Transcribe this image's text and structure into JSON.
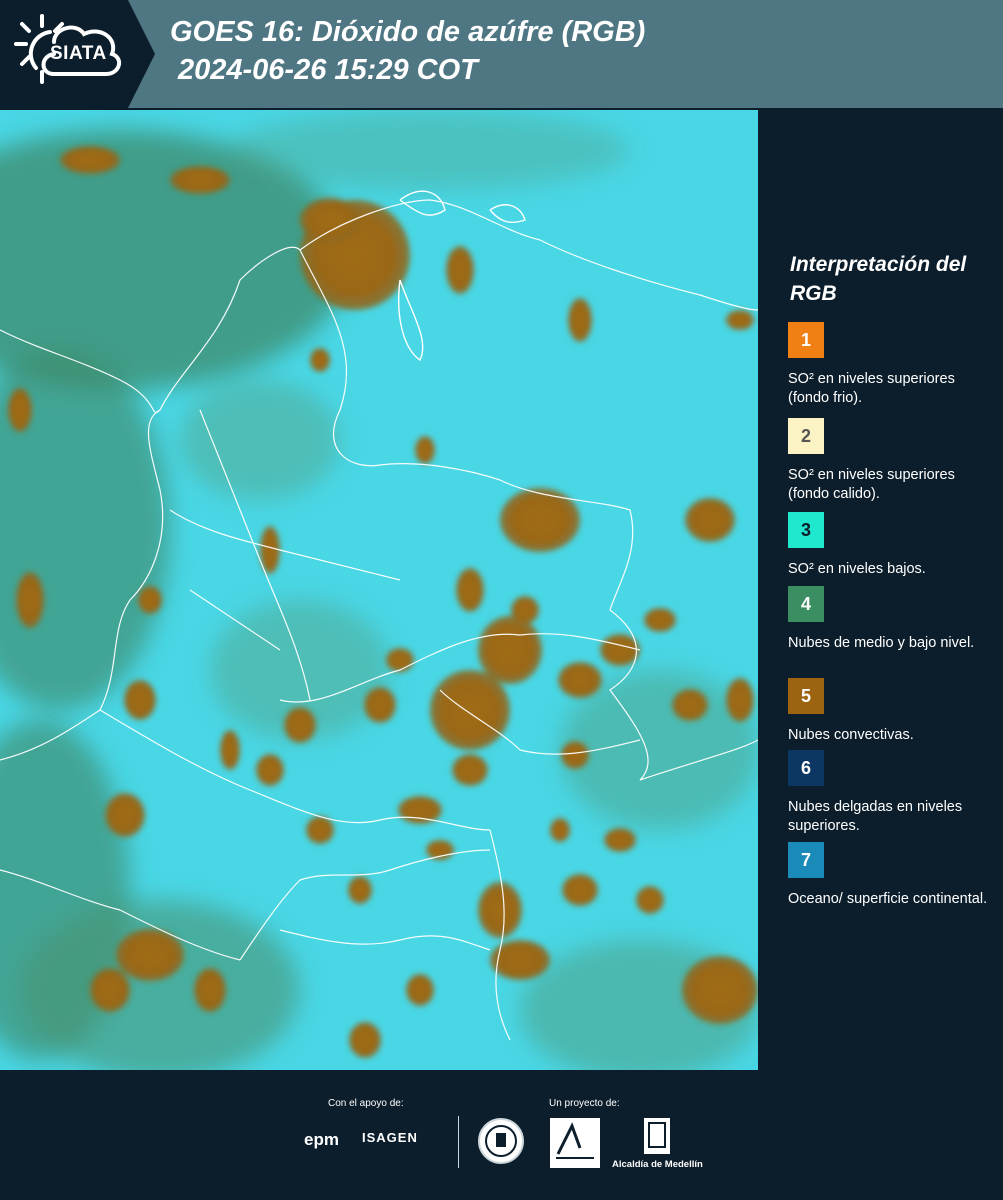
{
  "header": {
    "logo_text": "SIATA",
    "title_line1": "GOES 16: Dióxido de azúfre (RGB)",
    "title_line2": "2024-06-26 15:29 COT"
  },
  "legend": {
    "title": "Interpretación del RGB",
    "items": [
      {
        "number": "1",
        "color": "#f07f14",
        "number_color": "#ffffff",
        "text": "SO² en niveles superiores (fondo frio)."
      },
      {
        "number": "2",
        "color": "#fbf3c3",
        "number_color": "#555555",
        "text": "SO² en niveles superiores (fondo calido)."
      },
      {
        "number": "3",
        "color": "#1fe8ce",
        "number_color": "#0c1e2b",
        "text": "SO² en niveles bajos."
      },
      {
        "number": "4",
        "color": "#3a8e62",
        "number_color": "#ffffff",
        "text": "Nubes de medio y bajo nivel."
      },
      {
        "number": "5",
        "color": "#9c6410",
        "number_color": "#ffffff",
        "text": "Nubes convectivas."
      },
      {
        "number": "6",
        "color": "#0c3763",
        "number_color": "#ffffff",
        "text": "Nubes delgadas en niveles superiores."
      },
      {
        "number": "7",
        "color": "#1a8ab8",
        "number_color": "#ffffff",
        "text": "Oceano/ superficie continental."
      }
    ]
  },
  "footer": {
    "support_label": "Con el apoyo de:",
    "project_label": "Un proyecto de:",
    "sponsor1": "epm",
    "sponsor2": "ISAGEN",
    "partner_text": "Alcaldía de Medellín"
  }
}
